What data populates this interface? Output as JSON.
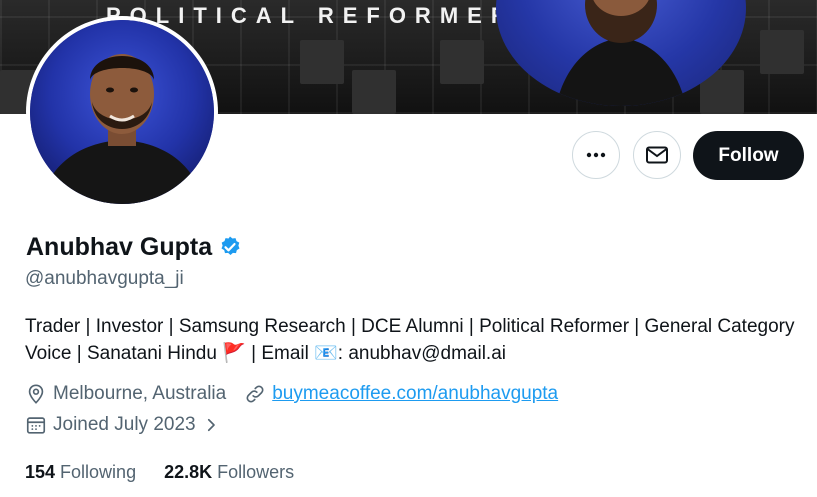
{
  "banner": {
    "title": "POLITICAL REFORMER"
  },
  "actions": {
    "follow_label": "Follow",
    "more_icon": "more-icon",
    "message_icon": "envelope-icon"
  },
  "profile": {
    "name": "Anubhav Gupta",
    "handle": "@anubhavgupta_ji",
    "bio": "Trader | Investor | Samsung Research | DCE Alumni | Political Reformer | General Category Voice | Sanatani Hindu 🚩 | Email 📧: anubhav@dmail.ai",
    "location": "Melbourne, Australia",
    "website": "buymeacoffee.com/anubhavgupta",
    "joined": "Joined July 2023"
  },
  "stats": {
    "following_count": "154",
    "following_label": "Following",
    "followers_count": "22.8K",
    "followers_label": "Followers"
  },
  "colors": {
    "verified": "#1d9bf0",
    "link": "#1d9bf0",
    "follow_bg": "#0f1419",
    "muted": "#536471"
  }
}
